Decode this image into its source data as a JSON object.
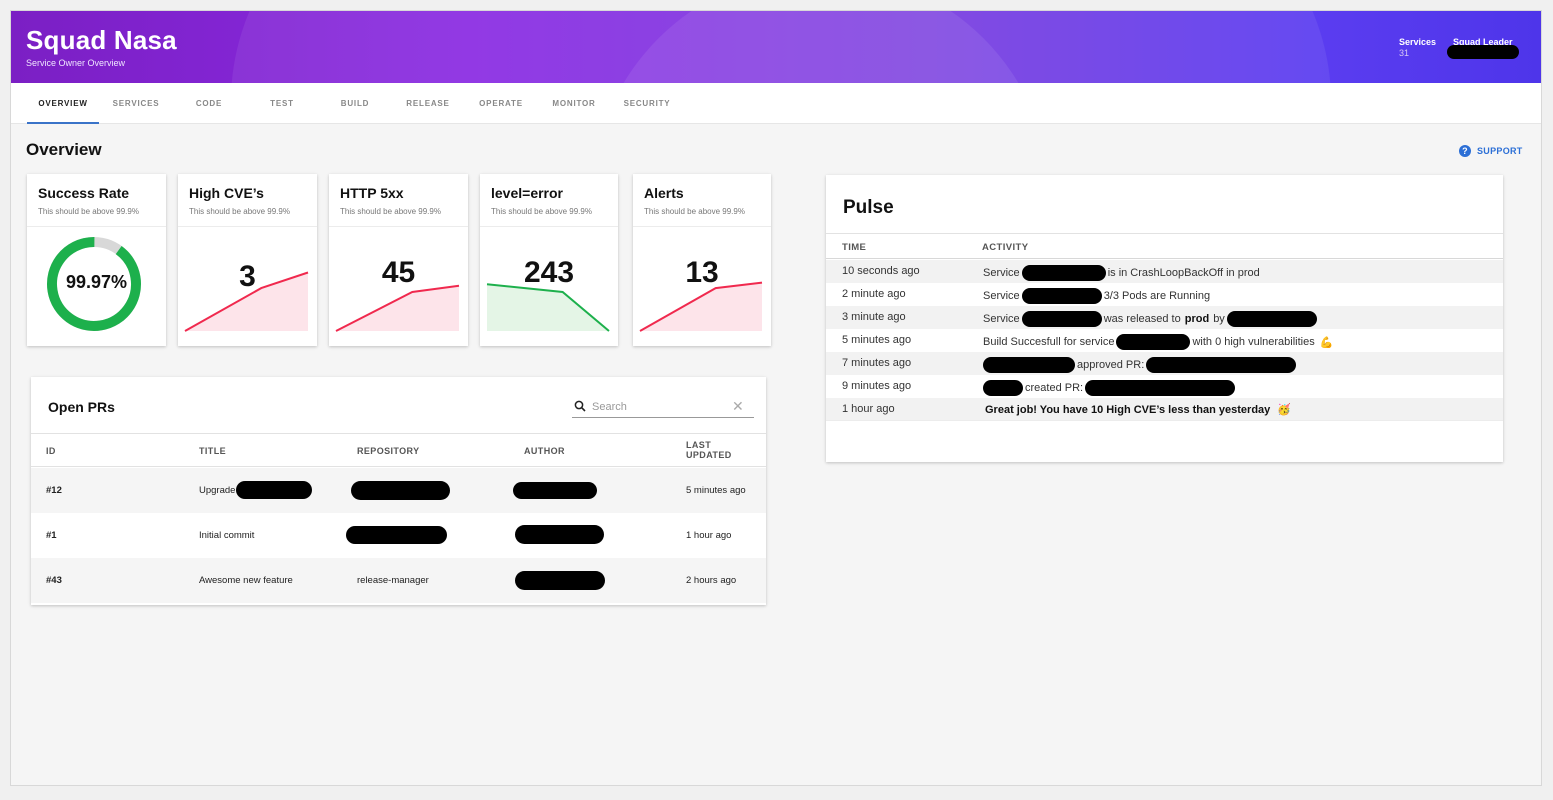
{
  "header": {
    "title": "Squad Nasa",
    "subtitle": "Service Owner Overview",
    "services_label": "Services",
    "services_count": "31",
    "role_label": "Squad Leader"
  },
  "tabs": [
    {
      "label": "OVERVIEW",
      "active": true
    },
    {
      "label": "SERVICES"
    },
    {
      "label": "CODE"
    },
    {
      "label": "TEST"
    },
    {
      "label": "BUILD"
    },
    {
      "label": "RELEASE"
    },
    {
      "label": "OPERATE"
    },
    {
      "label": "MONITOR"
    },
    {
      "label": "SECURITY"
    }
  ],
  "page": {
    "title": "Overview",
    "support_label": "SUPPORT",
    "support_icon": "help-circle-icon"
  },
  "metrics": [
    {
      "title": "Success Rate",
      "subtitle": "This should be above 99.9%",
      "value": "99.97%",
      "type": "donut",
      "success_fraction": 0.9,
      "color": "#1db04c"
    },
    {
      "title": "High CVE’s",
      "subtitle": "This should be above 99.9%",
      "value": "3",
      "type": "trend",
      "trend": [
        0,
        0.55,
        0.75
      ],
      "color": "#f0294e",
      "fill": "#fde4ea"
    },
    {
      "title": "HTTP 5xx",
      "subtitle": "This should be above 99.9%",
      "value": "45",
      "type": "trend",
      "trend": [
        0,
        0.5,
        0.58
      ],
      "color": "#f0294e",
      "fill": "#fde4ea"
    },
    {
      "title": "level=error",
      "subtitle": "This should be above 99.9%",
      "value": "243",
      "type": "trend",
      "trend": [
        0.6,
        0.5,
        0.0
      ],
      "color": "#1db04c",
      "fill": "#e4f5e6"
    },
    {
      "title": "Alerts",
      "subtitle": "This should be above 99.9%",
      "value": "13",
      "type": "trend",
      "trend": [
        0,
        0.55,
        0.62
      ],
      "color": "#f0294e",
      "fill": "#fde4ea"
    }
  ],
  "open_prs": {
    "title": "Open PRs",
    "search_placeholder": "Search",
    "search_icon": "search-icon",
    "clear_icon": "close-icon",
    "columns": [
      "ID",
      "TITLE",
      "REPOSITORY",
      "AUTHOR",
      "LAST UPDATED"
    ],
    "rows": [
      {
        "id": "#12",
        "title": "Upgrade",
        "repository": "",
        "author": "",
        "updated": "5 minutes ago"
      },
      {
        "id": "#1",
        "title": "Initial commit",
        "repository": "",
        "author": "",
        "updated": "1 hour ago"
      },
      {
        "id": "#43",
        "title": "Awesome new feature",
        "repository": "release-manager",
        "author": "",
        "updated": "2 hours ago"
      }
    ]
  },
  "pulse": {
    "title": "Pulse",
    "columns": [
      "TIME",
      "ACTIVITY"
    ],
    "rows": [
      {
        "time": "10 seconds ago",
        "parts": [
          {
            "t": "Service"
          },
          {
            "r": 84
          },
          {
            "t": "is in CrashLoopBackOff in prod"
          }
        ]
      },
      {
        "time": "2 minute ago",
        "parts": [
          {
            "t": "Service"
          },
          {
            "r": 80
          },
          {
            "t": "3/3 Pods are Running"
          }
        ]
      },
      {
        "time": "3 minute ago",
        "parts": [
          {
            "t": "Service"
          },
          {
            "r": 80
          },
          {
            "t": "was released to"
          },
          {
            "b": "prod"
          },
          {
            "t": "by"
          },
          {
            "r": 90
          }
        ]
      },
      {
        "time": "5 minutes ago",
        "parts": [
          {
            "t": "Build Succesfull for service"
          },
          {
            "r": 74
          },
          {
            "t": "with 0 high vulnerabilities"
          },
          {
            "e": "💪"
          }
        ]
      },
      {
        "time": "7 minutes ago",
        "parts": [
          {
            "r": 92
          },
          {
            "t": "approved PR:"
          },
          {
            "r": 150
          }
        ]
      },
      {
        "time": "9 minutes ago",
        "parts": [
          {
            "r": 40
          },
          {
            "t": "created PR:"
          },
          {
            "r": 150
          }
        ]
      },
      {
        "time": "1 hour ago",
        "parts": [
          {
            "b": "Great job! You have 10 High CVE’s less than yesterday"
          },
          {
            "e": "🥳"
          }
        ]
      }
    ]
  }
}
